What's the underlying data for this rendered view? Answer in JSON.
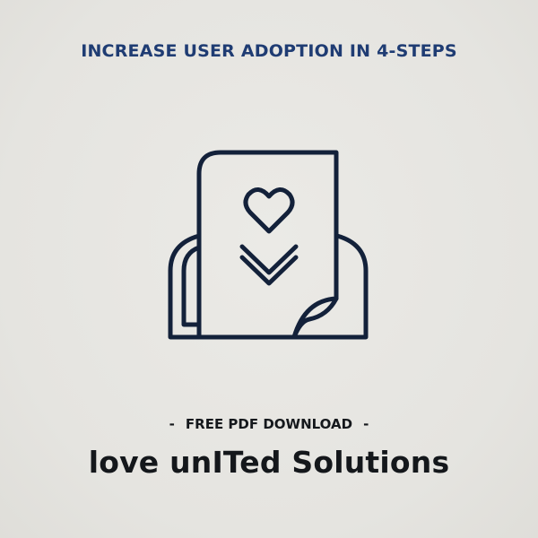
{
  "headline": "INCREASE USER ADOPTION IN 4-STEPS",
  "cta": {
    "dash_left": "-",
    "text": "FREE PDF DOWNLOAD",
    "dash_right": "-"
  },
  "brand": "love unITed Solutions",
  "icon": {
    "name": "document-heart-download-icon",
    "stroke_color": "#13213a"
  },
  "colors": {
    "background": "#e6e5e1",
    "headline": "#1f3c73",
    "text": "#14171b"
  }
}
